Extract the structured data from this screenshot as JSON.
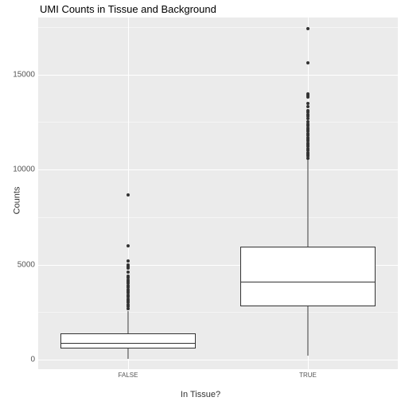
{
  "chart_data": {
    "type": "boxplot",
    "title": "UMI Counts in Tissue and Background",
    "xlabel": "In Tissue?",
    "ylabel": "Counts",
    "categories": [
      "FALSE",
      "TRUE"
    ],
    "ylim": [
      -500,
      18000
    ],
    "yticks": [
      0,
      5000,
      10000,
      15000
    ],
    "yminor": [
      2500,
      7500,
      12500,
      17500
    ],
    "series": [
      {
        "name": "FALSE",
        "q1": 600,
        "median": 900,
        "q3": 1400,
        "lower_whisker": 50,
        "upper_whisker": 2550,
        "outliers": [
          2700,
          2800,
          2900,
          3000,
          3100,
          3200,
          3300,
          3400,
          3500,
          3600,
          3700,
          3800,
          3900,
          4000,
          4100,
          4200,
          4300,
          4400,
          4600,
          4800,
          4900,
          5000,
          5200,
          6000,
          8650
        ]
      },
      {
        "name": "TRUE",
        "q1": 2800,
        "median": 4100,
        "q3": 5950,
        "lower_whisker": 200,
        "upper_whisker": 10500,
        "outliers": [
          10600,
          10700,
          10800,
          10900,
          11000,
          11100,
          11200,
          11300,
          11400,
          11500,
          11600,
          11700,
          11800,
          11900,
          12000,
          12100,
          12200,
          12300,
          12400,
          12500,
          12700,
          12800,
          12900,
          13000,
          13100,
          13300,
          13500,
          13800,
          13900,
          14000,
          15600,
          17400
        ]
      }
    ]
  }
}
